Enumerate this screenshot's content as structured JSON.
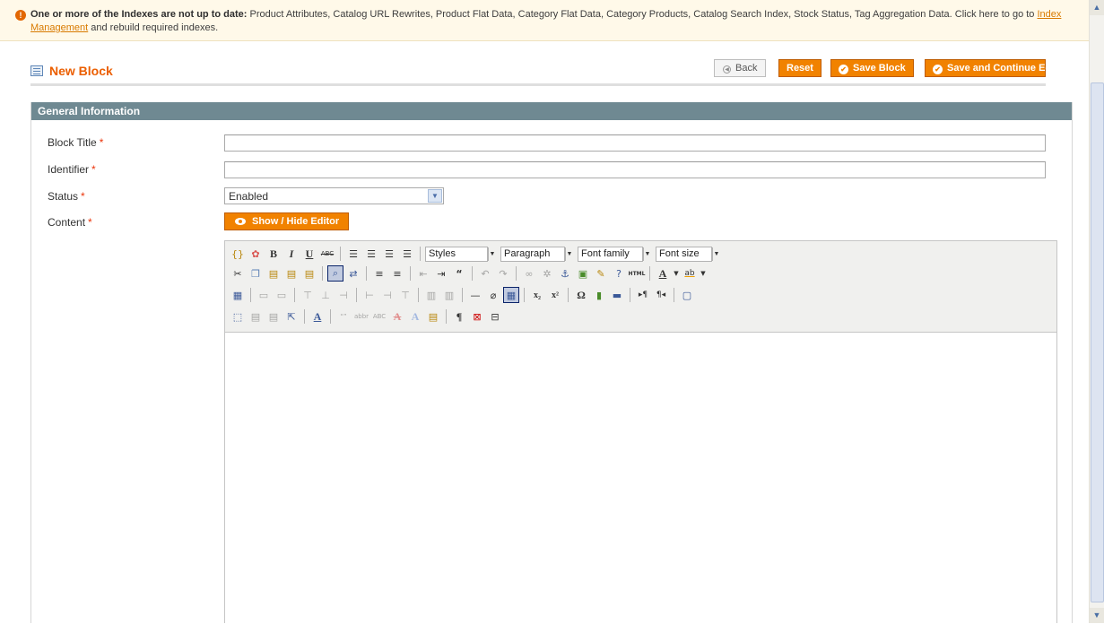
{
  "notice": {
    "bold": "One or more of the Indexes are not up to date:",
    "text": " Product Attributes, Catalog URL Rewrites, Product Flat Data, Category Flat Data, Category Products, Catalog Search Index, Stock Status, Tag Aggregation Data. Click here to go to ",
    "link": "Index Management",
    "tail": " and rebuild required indexes."
  },
  "header": {
    "title": "New Block",
    "back_label": "Back",
    "reset_label": "Reset",
    "save_label": "Save Block",
    "save_continue_label": "Save and Continue Edit"
  },
  "panel": {
    "title": "General Information",
    "fields": {
      "block_title": {
        "label": "Block Title",
        "value": ""
      },
      "identifier": {
        "label": "Identifier",
        "value": ""
      },
      "status": {
        "label": "Status",
        "value": "Enabled"
      },
      "content": {
        "label": "Content"
      }
    },
    "required_mark": "*",
    "toggle_editor_label": "Show / Hide Editor"
  },
  "editor": {
    "selects": {
      "styles": "Styles",
      "paragraph": "Paragraph",
      "font_family": "Font family",
      "font_size": "Font size"
    },
    "glyphs": {
      "bold": "B",
      "italic": "I",
      "underline": "U",
      "strike": "ABC",
      "html": "HTML",
      "text_color": "A",
      "bg_color": "ab",
      "sub": "x₂",
      "sup": "x²",
      "omega": "Ω",
      "pilcrow": "¶"
    }
  }
}
